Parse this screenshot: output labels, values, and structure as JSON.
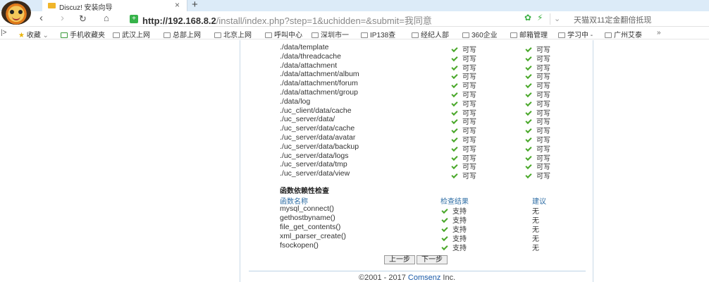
{
  "browser": {
    "tab_title": "Discuz! 安装向导",
    "tab_close": "×",
    "new_tab": "+",
    "url_host": "http://192.168.8.2",
    "url_path": "/install/index.php?step=1&uchidden=&submit=我同意",
    "promo_text": "天猫双11定金翻倍抵现",
    "bookmarks": [
      "收藏",
      "手机收藏夹",
      "武汉上网",
      "总部上网",
      "北京上网",
      "呼叫中心",
      "深圳市一",
      "IP138查",
      "经纪人部",
      "360企业",
      "邮箱管理",
      "学习中 -",
      "广州艾泰",
      "»"
    ]
  },
  "dirs": {
    "rows": [
      "./data/template",
      "./data/threadcache",
      "./data/attachment",
      "./data/attachment/album",
      "./data/attachment/forum",
      "./data/attachment/group",
      "./data/log",
      "./uc_client/data/cache",
      "./uc_server/data/",
      "./uc_server/data/cache",
      "./uc_server/data/avatar",
      "./uc_server/data/backup",
      "./uc_server/data/logs",
      "./uc_server/data/tmp",
      "./uc_server/data/view"
    ],
    "status_label": "可写"
  },
  "func": {
    "section_title": "函数依赖性检查",
    "col_name": "函数名称",
    "col_result": "检查结果",
    "col_advice": "建议",
    "rows": [
      {
        "name": "mysql_connect()",
        "result": "支持",
        "advice": "无"
      },
      {
        "name": "gethostbyname()",
        "result": "支持",
        "advice": "无"
      },
      {
        "name": "file_get_contents()",
        "result": "支持",
        "advice": "无"
      },
      {
        "name": "xml_parser_create()",
        "result": "支持",
        "advice": "无"
      },
      {
        "name": "fsockopen()",
        "result": "支持",
        "advice": "无"
      }
    ]
  },
  "buttons": {
    "prev": "上一步",
    "next": "下一步"
  },
  "footer": {
    "copyright": "©2001 - 2017 ",
    "company": "Comsenz",
    "suffix": " Inc."
  }
}
